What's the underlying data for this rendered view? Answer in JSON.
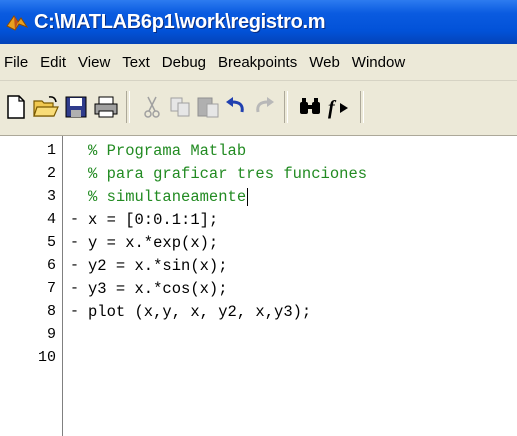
{
  "window": {
    "title": "C:\\MATLAB6p1\\work\\registro.m"
  },
  "menu": [
    "File",
    "Edit",
    "View",
    "Text",
    "Debug",
    "Breakpoints",
    "Web",
    "Window"
  ],
  "toolbar": {
    "icons": [
      "new-file-icon",
      "open-folder-icon",
      "save-icon",
      "print-icon",
      "cut-icon",
      "copy-icon",
      "paste-icon",
      "undo-icon",
      "redo-icon",
      "find-icon",
      "function-icon"
    ]
  },
  "editor": {
    "lines": [
      {
        "num": "1",
        "dash": "",
        "text": "% Programa Matlab",
        "kind": "comment"
      },
      {
        "num": "2",
        "dash": "",
        "text": "% para graficar tres funciones",
        "kind": "comment"
      },
      {
        "num": "3",
        "dash": "",
        "text": "% simultaneamente",
        "kind": "comment"
      },
      {
        "num": "4",
        "dash": "-",
        "text": "x = [0:0.1:1];",
        "kind": "code"
      },
      {
        "num": "5",
        "dash": "-",
        "text": "y = x.*exp(x);",
        "kind": "code"
      },
      {
        "num": "6",
        "dash": "-",
        "text": "y2 = x.*sin(x);",
        "kind": "code"
      },
      {
        "num": "7",
        "dash": "-",
        "text": "y3 = x.*cos(x);",
        "kind": "code"
      },
      {
        "num": "8",
        "dash": "-",
        "text": "plot (x,y, x, y2, x,y3);",
        "kind": "code"
      },
      {
        "num": "9",
        "dash": "",
        "text": "",
        "kind": "code"
      },
      {
        "num": "10",
        "dash": "",
        "text": "",
        "kind": "code"
      }
    ]
  },
  "colors": {
    "titlebar": "#0252d8",
    "comment": "#228b22",
    "chrome": "#ece9d8"
  }
}
